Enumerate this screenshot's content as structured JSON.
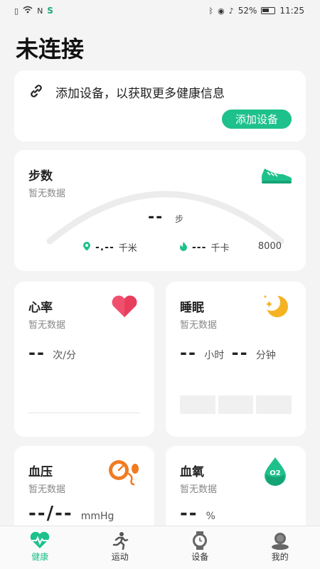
{
  "status_bar": {
    "battery": "52%",
    "time": "11:25",
    "left_icons": [
      "sim-icon",
      "wifi-icon",
      "nfc-icon",
      "app-s-icon"
    ],
    "right_icons": [
      "bluetooth-icon",
      "location-icon",
      "mute-icon",
      "battery-icon"
    ]
  },
  "page": {
    "title": "未连接"
  },
  "connect_card": {
    "text": "添加设备，以获取更多健康信息",
    "button": "添加设备",
    "icon": "link-icon"
  },
  "steps_card": {
    "title": "步数",
    "subtitle": "暂无数据",
    "value": "--",
    "unit": "步",
    "distance_value": "-.--",
    "distance_unit": "千米",
    "calories_value": "---",
    "calories_unit": "千卡",
    "goal": "8000",
    "progress": 0
  },
  "heart_rate_card": {
    "title": "心率",
    "subtitle": "暂无数据",
    "value": "--",
    "unit": "次/分"
  },
  "sleep_card": {
    "title": "睡眠",
    "subtitle": "暂无数据",
    "hours": "--",
    "hours_unit": "小时",
    "minutes": "--",
    "minutes_unit": "分钟"
  },
  "bp_card": {
    "title": "血压",
    "subtitle": "暂无数据",
    "value": "--/--",
    "unit": "mmHg"
  },
  "spo2_card": {
    "title": "血氧",
    "subtitle": "暂无数据",
    "value": "--",
    "unit": "%",
    "icon_text": "O2"
  },
  "tabs": [
    {
      "label": "健康",
      "active": true
    },
    {
      "label": "运动",
      "active": false
    },
    {
      "label": "设备",
      "active": false
    },
    {
      "label": "我的",
      "active": false
    }
  ],
  "colors": {
    "accent": "#1ec18b",
    "heart": "#f0506e",
    "moon": "#f5b324",
    "bp": "#f07c22"
  }
}
